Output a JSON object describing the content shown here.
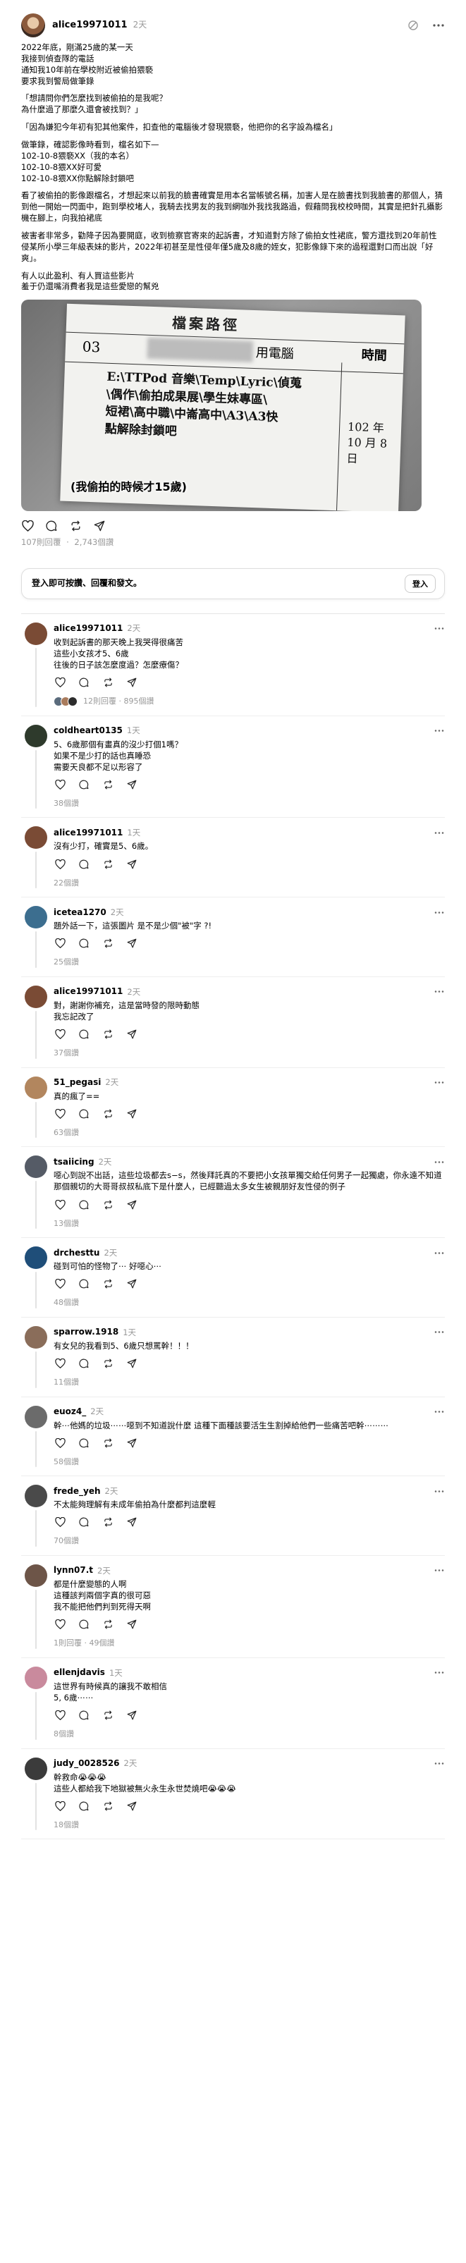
{
  "post": {
    "username": "alice19971011",
    "time": "2天",
    "paragraphs": [
      [
        "2022年底，剛滿25歲的某一天",
        "我接到偵查隊的電話",
        "通知我10年前在學校附近被偷拍猥褻",
        "要求我到警局做筆錄"
      ],
      [
        "「想請問你們怎麼找到被偷拍的是我呢？",
        "為什麼過了那麼久還會被找到？」"
      ],
      [
        "「因為嫌犯今年初有犯其他案件，扣查他的電腦後才發現猥褻，他把你的名字設為檔名」"
      ],
      [
        "做筆錄，確認影像時看到，檔名如下—",
        "102-10-8猥褻XX（我的本名）",
        "102-10-8猥XX好可愛",
        "102-10-8猥XX你點解除封鎖吧"
      ],
      [
        "看了被偷拍的影像跟檔名，才想起來以前我的臉書確實是用本名當帳號名稱，加害人是在臉書找到我臉書的那個人，猜到他一開始一閃面中，跑到學校堵人，我騎去找男友的我到網咖外我找我路過，假藉問我校校時間，其實是把針孔攝影機在腳上，向我拍裙底"
      ],
      [
        "被害者非常多，勸降子因為要開庭，收到檢察官寄來的起訴書，才知道對方除了偷拍女性裙底，警方還找到20年前性侵某所小學三年級表妹的影片，2022年初甚至是性侵年僅5歲及8歲的姪女，犯影像錄下來的過程還對口而出說「好爽」。"
      ],
      [
        "有人以此盈利、有人買這些影片",
        "羞于仍還嘴消費者我是這些愛戀的幫兇"
      ]
    ],
    "image": {
      "doc_title": "檔案路徑",
      "doc_number": "03",
      "doc_pc": "用電腦",
      "doc_time_header": "時間",
      "doc_path_lines": [
        "E:\\TTPod 音樂\\Temp\\Lyric\\偵蒐",
        "\\偶作\\偷拍成果展\\學生妹專區\\",
        "短裙\\高中職\\中崙高中\\A3\\A3快",
        "點解除封鎖吧"
      ],
      "doc_date_lines": [
        "102 年",
        "10 月 8 日"
      ],
      "caption": "(我偷拍的時候才15歲)"
    },
    "stats": {
      "replies": "107則回覆",
      "likes": "2,743個讚",
      "separator": "·"
    }
  },
  "login_prompt": {
    "text": "登入即可按讚、回覆和發文。",
    "button": "登入"
  },
  "comments": [
    {
      "username": "alice19971011",
      "time": "2天",
      "lines": [
        "收到起訴書的那天晚上我哭得很痛苦",
        "這些小女孩才5、6歲",
        "往後的日子該怎麼度過？怎麼療傷？"
      ],
      "likes_text": "12則回覆 · 895個讚",
      "show_mini_avatars": true,
      "avatar_color": "#7a4b35"
    },
    {
      "username": "coldheart0135",
      "time": "1天",
      "lines": [
        "5、6歲那個有畫真的沒少打個1嗎？",
        "如果不是少打的話也真睡恐",
        "需要天良都不足以形容了"
      ],
      "likes_text": "38個讚",
      "show_mini_avatars": false,
      "avatar_color": "#2e3a2c"
    },
    {
      "username": "alice19971011",
      "time": "1天",
      "lines": [
        "沒有少打，確實是5、6歲。"
      ],
      "likes_text": "22個讚",
      "show_mini_avatars": false,
      "avatar_color": "#7a4b35"
    },
    {
      "username": "icetea1270",
      "time": "2天",
      "lines": [
        "題外話一下，這張圖片 是不是少個\"被\"字 ?!"
      ],
      "likes_text": "25個讚",
      "show_mini_avatars": false,
      "avatar_color": "#3c6e8f"
    },
    {
      "username": "alice19971011",
      "time": "2天",
      "lines": [
        "對，謝謝你補充，這是當時發的限時動態",
        "我忘記改了"
      ],
      "likes_text": "37個讚",
      "show_mini_avatars": false,
      "avatar_color": "#7a4b35"
    },
    {
      "username": "51_pegasi",
      "time": "2天",
      "lines": [
        "真的瘋了=="
      ],
      "likes_text": "63個讚",
      "show_mini_avatars": false,
      "avatar_color": "#b2865e"
    },
    {
      "username": "tsaiicing",
      "time": "2天",
      "lines": [
        "噁心到說不出話，這些垃圾都去s−s，然後拜託真的不要把小女孩單獨交給任何男子一起獨處，你永遠不知道那個親切的大哥哥叔叔私底下是什麼人，已經聽過太多女生被親朋好友性侵的例子"
      ],
      "likes_text": "13個讚",
      "show_mini_avatars": false,
      "avatar_color": "#555b66"
    },
    {
      "username": "drchesttu",
      "time": "2天",
      "lines": [
        "碰到可怕的怪物了⋯ 好噁心⋯"
      ],
      "likes_text": "48個讚",
      "show_mini_avatars": false,
      "avatar_color": "#1f4e79"
    },
    {
      "username": "sparrow.1918",
      "time": "1天",
      "lines": [
        "有女兒的我看到5、6歲只想罵幹！！！"
      ],
      "likes_text": "11個讚",
      "show_mini_avatars": false,
      "avatar_color": "#8a6d5a"
    },
    {
      "username": "euoz4_",
      "time": "2天",
      "lines": [
        "幹⋯他媽的垃圾⋯⋯噁到不知道說什麼 這種下面種該要活生生割掉給他們一些痛苦吧幹⋯⋯⋯"
      ],
      "likes_text": "58個讚",
      "show_mini_avatars": false,
      "avatar_color": "#6b6b6b"
    },
    {
      "username": "frede_yeh",
      "time": "2天",
      "lines": [
        "不太能夠理解有未成年偷拍為什麼都判這麼輕"
      ],
      "likes_text": "70個讚",
      "show_mini_avatars": false,
      "avatar_color": "#4a4a4a"
    },
    {
      "username": "lynn07.t",
      "time": "2天",
      "lines": [
        "都是什麼變態的人啊",
        "這種該判兩個字真的很可惡",
        "我不能把他們判到死得天啊"
      ],
      "likes_text": "1則回覆 · 49個讚",
      "show_mini_avatars": false,
      "avatar_color": "#6d5548"
    },
    {
      "username": "ellenjdavis",
      "time": "1天",
      "lines": [
        "這世界有時候真的讓我不敢相信",
        "5, 6歲⋯⋯"
      ],
      "likes_text": "8個讚",
      "show_mini_avatars": false,
      "avatar_color": "#c98a9d"
    },
    {
      "username": "judy_0028526",
      "time": "2天",
      "lines": [
        "幹救命😭😭😭",
        "這些人都給我下地獄被無火永生永世焚燒吧😭😭😭"
      ],
      "likes_text": "18個讚",
      "show_mini_avatars": false,
      "avatar_color": "#3b3b3b"
    }
  ]
}
